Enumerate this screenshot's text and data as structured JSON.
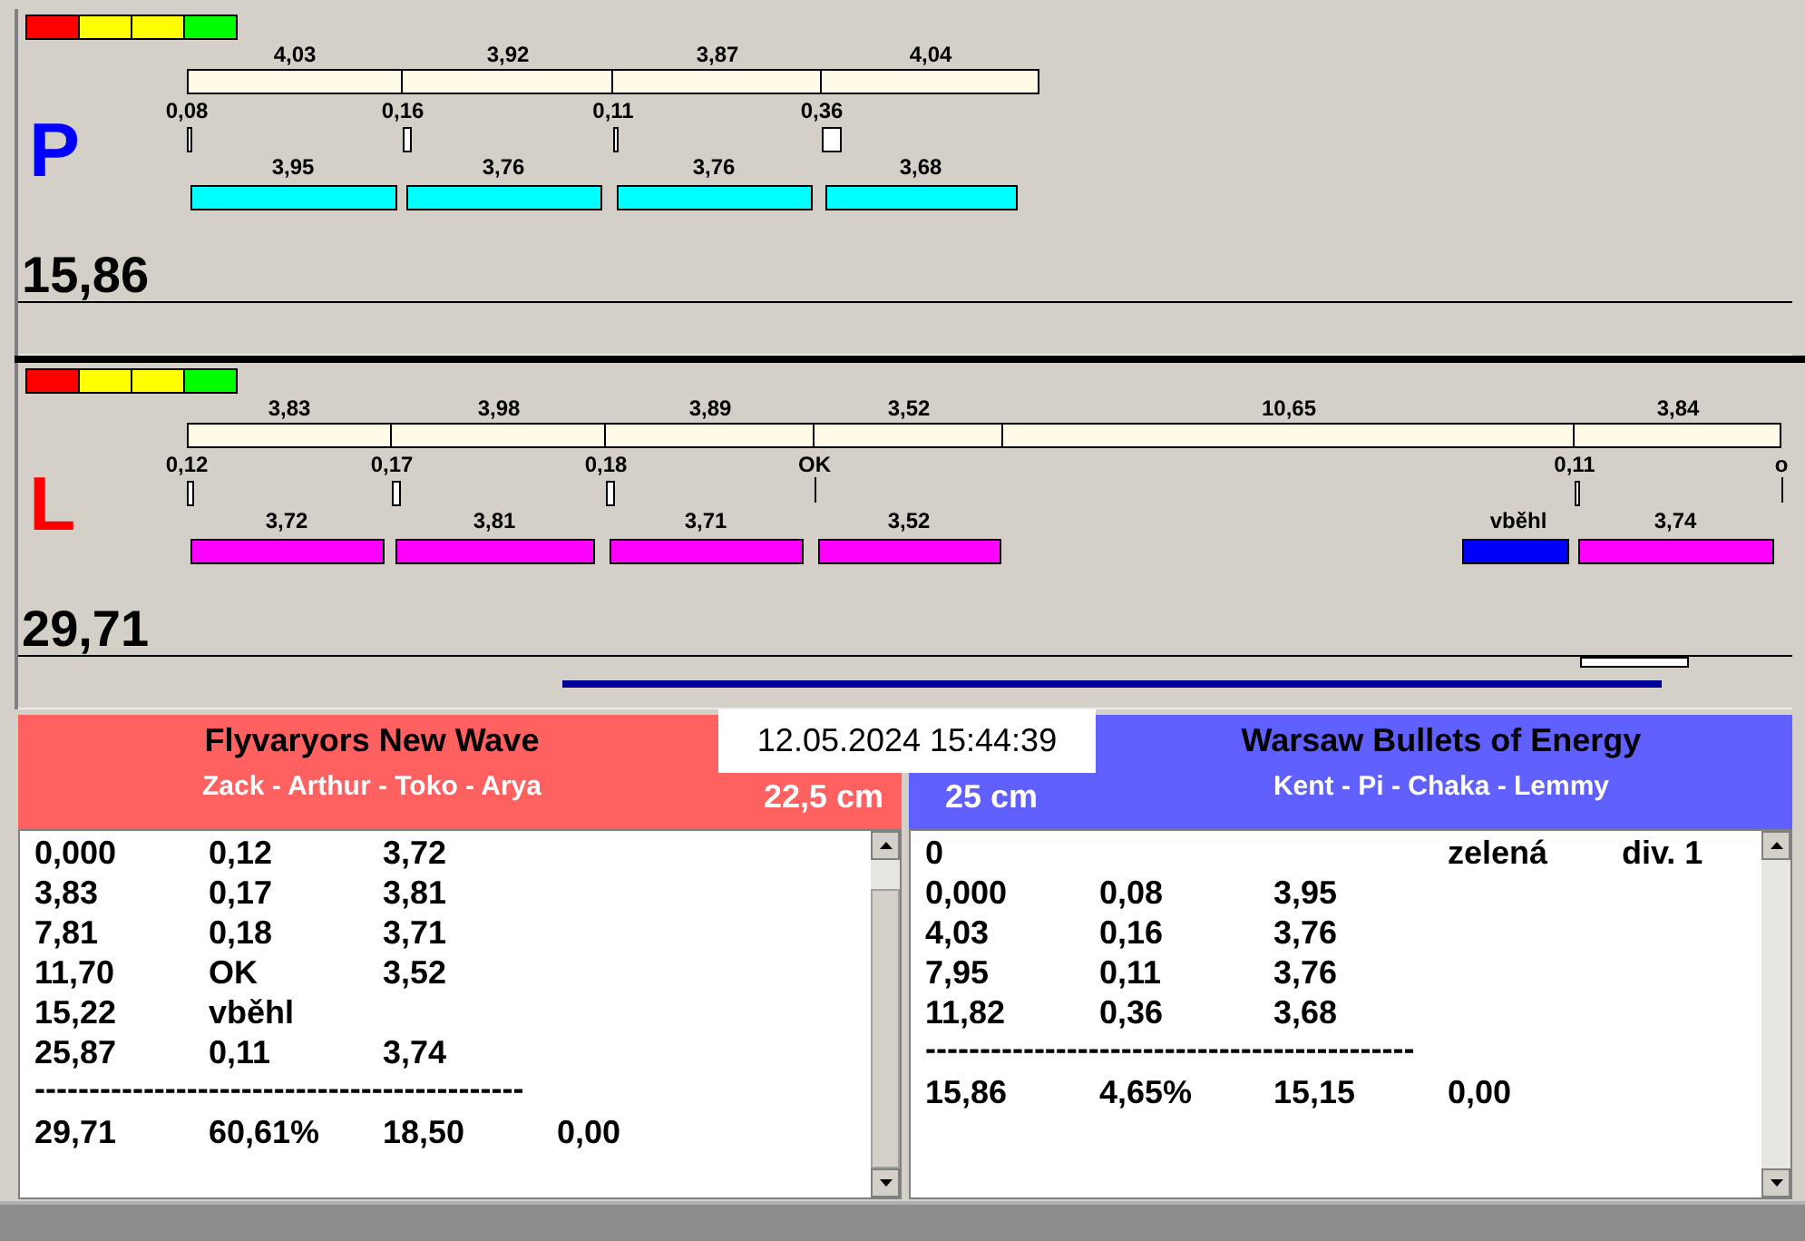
{
  "lanes": [
    {
      "letter": "P",
      "color": "#0000ff",
      "total": "15,86",
      "progress_line": false,
      "lights": [
        {
          "color": "#ff0000"
        },
        {
          "color": "#ffff00"
        },
        {
          "color": "#ffff00"
        },
        {
          "color": "#00ff00"
        }
      ],
      "splits": [
        {
          "time": "4,03",
          "gap": "0,08",
          "run": {
            "kind": "run",
            "text": "3,95",
            "color": "#00ffff"
          }
        },
        {
          "time": "3,92",
          "gap": "0,16",
          "run": {
            "kind": "run",
            "text": "3,76",
            "color": "#00ffff"
          }
        },
        {
          "time": "3,87",
          "gap": "0,11",
          "run": {
            "kind": "run",
            "text": "3,76",
            "color": "#00ffff"
          }
        },
        {
          "time": "4,04",
          "gap": "0,36",
          "run": {
            "kind": "run",
            "text": "3,68",
            "color": "#00ffff"
          }
        }
      ]
    },
    {
      "letter": "L",
      "color": "#ff0000",
      "total": "29,71",
      "progress_line": true,
      "lights": [
        {
          "color": "#ff0000"
        },
        {
          "color": "#ffff00"
        },
        {
          "color": "#ffff00"
        },
        {
          "color": "#00ff00"
        }
      ],
      "splits": [
        {
          "time": "3,83",
          "gap": "0,12",
          "run": {
            "kind": "run",
            "text": "3,72",
            "color": "#ff00ff"
          }
        },
        {
          "time": "3,98",
          "gap": "0,17",
          "run": {
            "kind": "run",
            "text": "3,81",
            "color": "#ff00ff"
          }
        },
        {
          "time": "3,89",
          "gap": "0,18",
          "run": {
            "kind": "run",
            "text": "3,71",
            "color": "#ff00ff"
          }
        },
        {
          "time": "3,52",
          "gap": "OK",
          "run": {
            "kind": "run",
            "text": "3,52",
            "color": "#ff00ff"
          }
        },
        {
          "time": "10,65",
          "run": {
            "kind": "rerun",
            "text": "vběhl",
            "color": "#0000ff"
          }
        },
        {
          "time": "3,84",
          "gap": "0,11",
          "run": {
            "kind": "run",
            "text": "3,74",
            "color": "#ff00ff"
          }
        }
      ],
      "end_marker": "o"
    }
  ],
  "datetime": "12.05.2024 15:44:39",
  "teams": [
    {
      "name": "Flyvaryors New Wave",
      "members": "Zack - Arthur - Toko - Arya",
      "height": "22,5 cm",
      "color": "#ff6060",
      "rows": [
        {
          "kind": "row",
          "col_1": "0,000",
          "col_2": "0,12",
          "col_3": "3,72"
        },
        {
          "kind": "row",
          "col_1": "3,83",
          "col_2": "0,17",
          "col_3": "3,81"
        },
        {
          "kind": "row",
          "col_1": "7,81",
          "col_2": "0,18",
          "col_3": "3,71"
        },
        {
          "kind": "row",
          "col_1": "11,70",
          "col_2": "OK",
          "col_3": "3,52"
        },
        {
          "kind": "row",
          "col_1": "15,22",
          "col_2": "vběhl"
        },
        {
          "kind": "row",
          "col_1": "25,87",
          "col_2": "0,11",
          "col_3": "3,74"
        },
        {
          "kind": "divider",
          "text": "---------------------------------------------"
        },
        {
          "kind": "row",
          "col_1": "29,71",
          "col_2": "60,61%",
          "col_3": "18,50",
          "col_4": "0,00"
        }
      ]
    },
    {
      "name": "Warsaw Bullets of Energy",
      "members": "Kent - Pi - Chaka - Lemmy",
      "height": "25 cm",
      "color": "#6060ff",
      "rows": [
        {
          "kind": "row",
          "col_1": "0",
          "col_4": "zelená",
          "col_5": "div. 1"
        },
        {
          "kind": "row",
          "col_1": "0,000",
          "col_2": "0,08",
          "col_3": "3,95"
        },
        {
          "kind": "row",
          "col_1": "4,03",
          "col_2": "0,16",
          "col_3": "3,76"
        },
        {
          "kind": "row",
          "col_1": "7,95",
          "col_2": "0,11",
          "col_3": "3,76"
        },
        {
          "kind": "row",
          "col_1": "11,82",
          "col_2": "0,36",
          "col_3": "3,68"
        },
        {
          "kind": "divider",
          "text": "---------------------------------------------"
        },
        {
          "kind": "row",
          "col_1": "15,86",
          "col_2": "4,65%",
          "col_3": "15,15",
          "col_4": "0,00"
        }
      ]
    }
  ]
}
